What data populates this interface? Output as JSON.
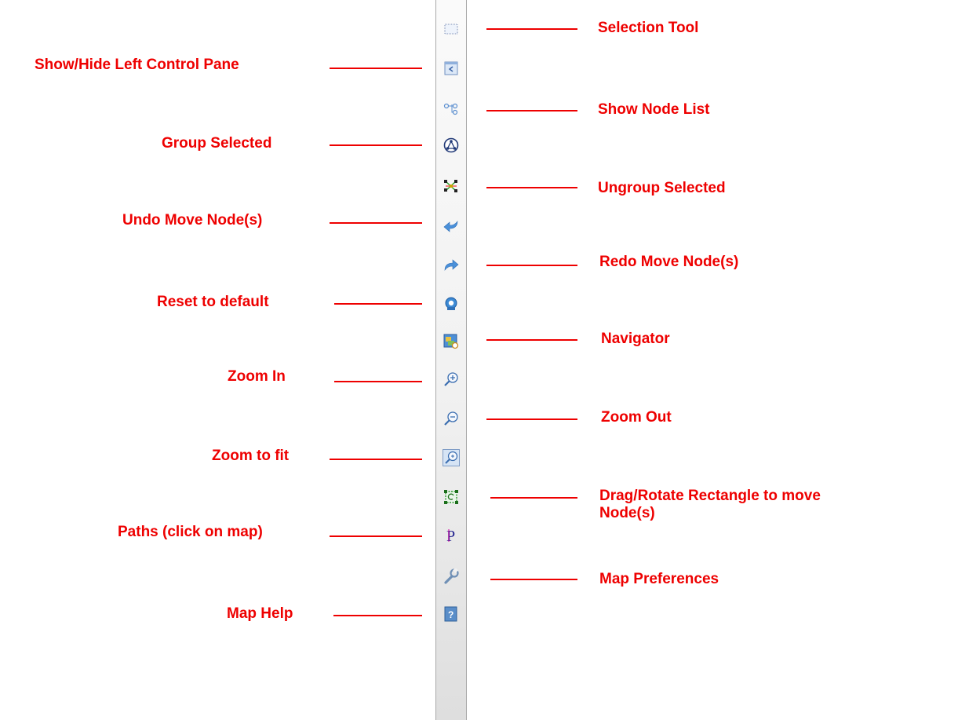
{
  "toolbar": {
    "tools": [
      {
        "id": "selection-tool",
        "icon": "selection-rect-icon",
        "label": "Selection Tool",
        "side": "right"
      },
      {
        "id": "show-hide-left-pane",
        "icon": "pane-toggle-icon",
        "label": "Show/Hide Left Control Pane",
        "side": "left"
      },
      {
        "id": "show-node-list",
        "icon": "node-list-icon",
        "label": "Show Node List",
        "side": "right"
      },
      {
        "id": "group-selected",
        "icon": "group-icon",
        "label": "Group Selected",
        "side": "left"
      },
      {
        "id": "ungroup-selected",
        "icon": "ungroup-icon",
        "label": "Ungroup Selected",
        "side": "right"
      },
      {
        "id": "undo-move",
        "icon": "undo-arrow-icon",
        "label": "Undo Move Node(s)",
        "side": "left"
      },
      {
        "id": "redo-move",
        "icon": "redo-arrow-icon",
        "label": "Redo Move Node(s)",
        "side": "right"
      },
      {
        "id": "reset-default",
        "icon": "reset-icon",
        "label": "Reset to default",
        "side": "left"
      },
      {
        "id": "navigator",
        "icon": "navigator-icon",
        "label": "Navigator",
        "side": "right"
      },
      {
        "id": "zoom-in",
        "icon": "zoom-in-icon",
        "label": "Zoom In",
        "side": "left"
      },
      {
        "id": "zoom-out",
        "icon": "zoom-out-icon",
        "label": "Zoom Out",
        "side": "right"
      },
      {
        "id": "zoom-fit",
        "icon": "zoom-fit-icon",
        "label": "Zoom to fit",
        "side": "left"
      },
      {
        "id": "drag-rotate",
        "icon": "drag-rotate-icon",
        "label": "Drag/Rotate Rectangle to move Node(s)",
        "side": "right"
      },
      {
        "id": "paths",
        "icon": "paths-icon",
        "label": "Paths (click on map)",
        "side": "left"
      },
      {
        "id": "map-preferences",
        "icon": "wrench-icon",
        "label": "Map Preferences",
        "side": "right"
      },
      {
        "id": "map-help",
        "icon": "help-icon",
        "label": "Map Help",
        "side": "left"
      }
    ]
  },
  "colors": {
    "annotation": "#ee0000",
    "toolbar_border": "#a9a9a9",
    "icon_blue": "#4a7fc1"
  }
}
